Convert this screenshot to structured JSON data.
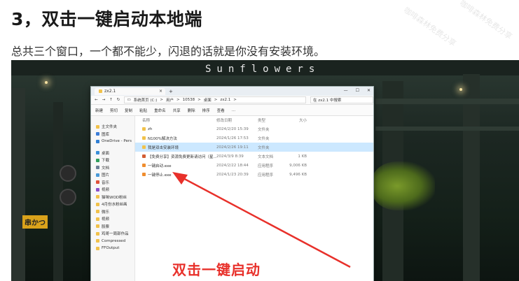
{
  "heading": "3，双击一键启动本地端",
  "intro": "总共三个窗口，一个都不能少，闪退的话就是你没有安装环境。",
  "screenshot": {
    "banner": "Sunflowers",
    "sign_text": "串かつ",
    "callout": "双击一键启动",
    "explorer": {
      "tab_title": "zx2.1",
      "tab_close": "×",
      "new_tab": "+",
      "window_controls": [
        "—",
        "☐",
        "✕"
      ],
      "address_path": [
        "系统首页 (C:)",
        ">",
        "用户",
        ">",
        "10538",
        ">",
        "桌面",
        ">",
        "zx2.1",
        ">"
      ],
      "search_placeholder": "在 zx2.1 中搜索",
      "toolbar": [
        "新建",
        "剪切",
        "复制",
        "粘贴",
        "重命名",
        "共享",
        "删除",
        "排序",
        "查看",
        "…"
      ],
      "nav": [
        {
          "label": "主文件夹",
          "color": "#f1c24b"
        },
        {
          "label": "图库",
          "color": "#3b7dd8"
        },
        {
          "label": "OneDrive - Pers",
          "color": "#2f7fd4"
        },
        {
          "label": "",
          "color": ""
        },
        {
          "label": "桌面",
          "color": "#3a8fd9"
        },
        {
          "label": "下载",
          "color": "#2f9e5b"
        },
        {
          "label": "文档",
          "color": "#6c7f96"
        },
        {
          "label": "图片",
          "color": "#4a9ad8"
        },
        {
          "label": "音乐",
          "color": "#e0523a"
        },
        {
          "label": "视频",
          "color": "#8c4fc9"
        },
        {
          "label": "猫咪WOD粉丝",
          "color": "#f1c24b"
        },
        {
          "label": "4月份水粉丝画",
          "color": "#f1c24b"
        },
        {
          "label": "微乐",
          "color": "#f1c24b"
        },
        {
          "label": "视频",
          "color": "#f1c24b"
        },
        {
          "label": "股票",
          "color": "#f1c24b"
        },
        {
          "label": "鸡哥一周部作品",
          "color": "#f1c24b"
        },
        {
          "label": "Compressed",
          "color": "#f1c24b"
        },
        {
          "label": "FFOutput",
          "color": "#f1c24b"
        }
      ],
      "columns": [
        "名称",
        "修改日期",
        "类型",
        "大小"
      ],
      "rows": [
        {
          "name": "zh",
          "date": "2024/2/20 15:39",
          "type": "文件夹",
          "size": "",
          "kind": "folder",
          "selected": false
        },
        {
          "name": "N100%解决方法",
          "date": "2024/1/26 17:53",
          "type": "文件夹",
          "size": "",
          "kind": "folder",
          "selected": false
        },
        {
          "name": "我是双击安装环境",
          "date": "2024/2/26 19:11",
          "type": "文件夹",
          "size": "",
          "kind": "folder",
          "selected": true
        },
        {
          "name": "【免费分享】资源免费更新请访问（星...",
          "date": "2024/3/9 8:39",
          "type": "文本文档",
          "size": "1 KB",
          "kind": "file",
          "selected": false
        },
        {
          "name": "一键启动.exe",
          "date": "2024/2/22 18:44",
          "type": "应用程序",
          "size": "9,006 KB",
          "kind": "exe",
          "selected": false
        },
        {
          "name": "一键停止.exe",
          "date": "2024/1/23 20:39",
          "type": "应用程序",
          "size": "9,496 KB",
          "kind": "exe",
          "selected": false
        }
      ]
    }
  },
  "watermark": "咖啡森林免费分享"
}
